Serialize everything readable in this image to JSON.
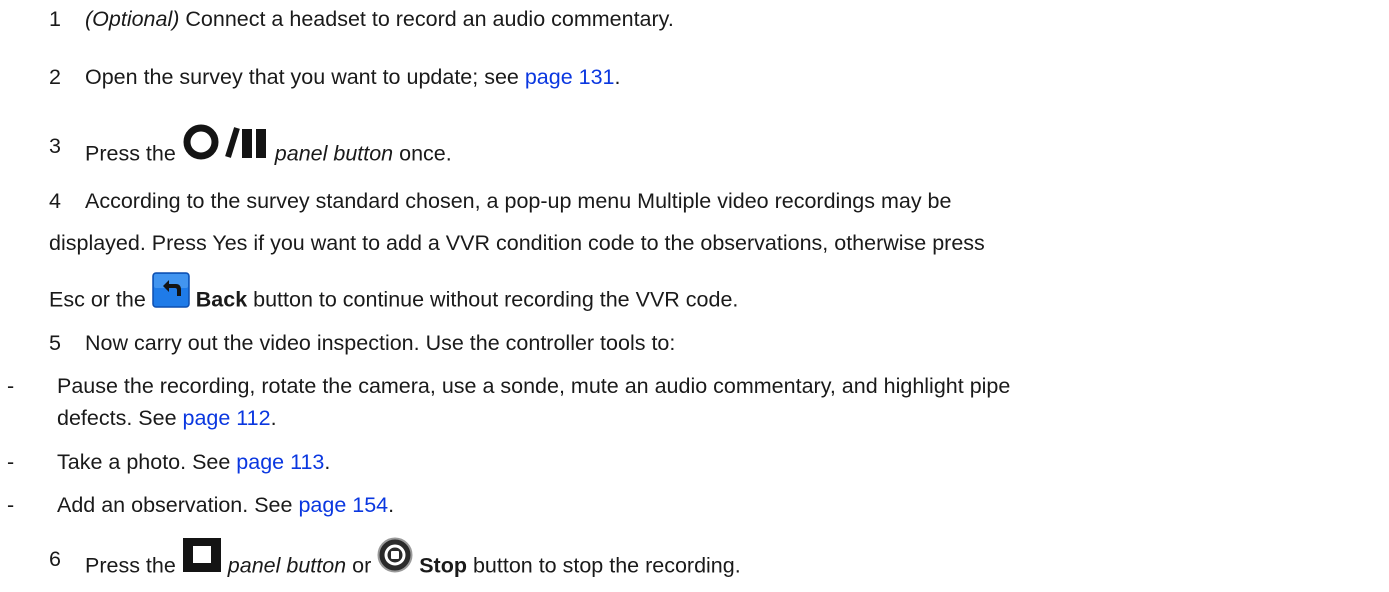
{
  "steps": [
    {
      "num": "1",
      "italic": "(Optional)",
      "text": " Connect a headset to record an audio commentary."
    },
    {
      "num": "2",
      "text": "Open the survey that you want to update; see ",
      "link": "page 131",
      "after": "."
    },
    {
      "num": "3",
      "pre": "Press the ",
      "icon": "record-pause-icon",
      "italic": "panel button",
      "post": " once."
    },
    {
      "num": "4",
      "line1": "According to the survey standard chosen, a pop-up menu Multiple video recordings may be",
      "line2": "displayed. Press Yes if you want to add a VVR condition code to the observations, otherwise press",
      "line3_pre": "Esc or the ",
      "icon": "back-arrow-icon",
      "bold": "Back",
      "line3_post": " button to continue without recording the VVR code."
    },
    {
      "num": "5",
      "text": "Now carry out the video inspection. Use the controller tools to:"
    },
    {
      "num": "6",
      "pre": "Press the ",
      "icon1": "stop-square-icon",
      "italic": "panel button",
      "mid": " or ",
      "icon2": "stop-circle-icon",
      "bold": "Stop",
      "post": " button to stop the recording."
    }
  ],
  "bullets": [
    {
      "marker": "-",
      "line1": "Pause the recording, rotate the camera, use a sonde, mute an audio commentary, and highlight pipe",
      "line2": "defects. See ",
      "link": "page 112",
      "after": "."
    },
    {
      "marker": "-",
      "text": "Take a photo. See ",
      "link": "page 113",
      "after": "."
    },
    {
      "marker": "-",
      "text": "Add an observation. See ",
      "link": "page 154",
      "after": "."
    }
  ],
  "colors": {
    "link": "#0a37e0",
    "back_button": "#1f7be8",
    "icon_dark": "#141414"
  }
}
